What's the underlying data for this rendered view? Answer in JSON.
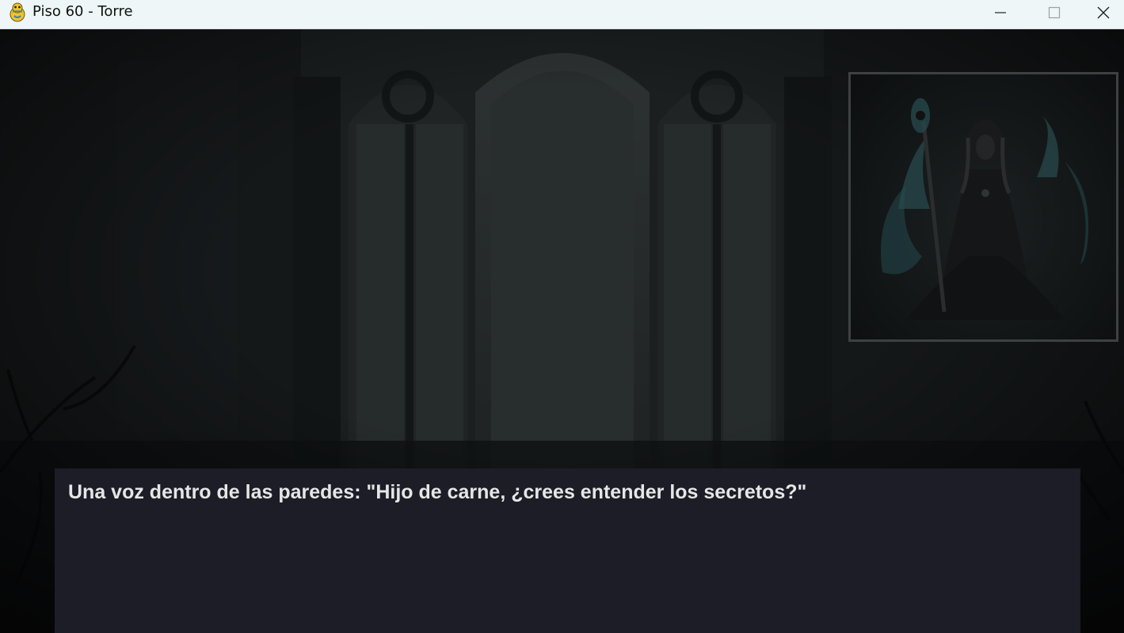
{
  "window": {
    "title": "Piso 60 - Torre",
    "app_icon": "pygame-snake-icon",
    "controls": {
      "minimize_icon": "minimize-icon",
      "maximize_icon": "maximize-icon",
      "close_icon": "close-icon"
    }
  },
  "scene": {
    "background": "gothic-cathedral-window-night-rain",
    "portrait": "dark-sorcerer-with-staff-and-spectral-flames"
  },
  "dialogue": {
    "text": "Una voz dentro de las paredes: \"Hijo de carne, ¿crees entender los secretos?\""
  },
  "colors": {
    "titlebar_bg": "#eef6f8",
    "dialogue_bg": "#1c1d26",
    "dialogue_text": "#e6e6e6",
    "portrait_border": "#3e4142"
  }
}
